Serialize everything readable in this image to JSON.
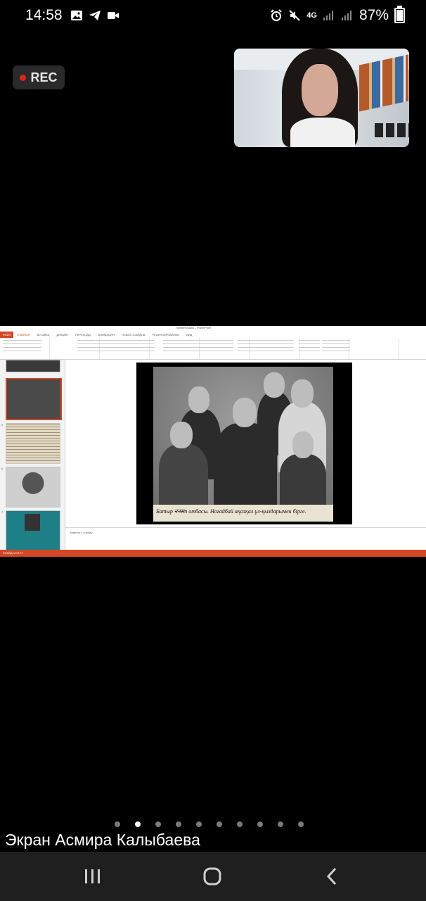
{
  "status_bar": {
    "time": "14:58",
    "network": "4G",
    "battery": "87%",
    "battery_level": 0.87
  },
  "recording": {
    "label": "REC",
    "dot_color": "#e3231b"
  },
  "shared_screen": {
    "app_title": "Презентация1 - PowerPoint",
    "file_tab": "ФАЙЛ",
    "tabs": [
      "ГЛАВНАЯ",
      "ВСТАВКА",
      "ДИЗАЙН",
      "ПЕРЕХОДЫ",
      "АНИМАЦИЯ",
      "ПОКАЗ СЛАЙДОВ",
      "РЕЦЕНЗИРОВАНИЕ",
      "ВИД"
    ],
    "active_tab": "ГЛАВНАЯ",
    "slide_caption": "Батыр ननसn отбасы. Ноғайбай ақсақал ұл-қыздарымен бірге.",
    "notes_placeholder": "Заметки к слайду",
    "status_text": "СЛАЙД 4 ИЗ 17",
    "accent_color": "#d24726"
  },
  "pager": {
    "count": 10,
    "active_index": 1
  },
  "screen_owner": "Экран Асмира Калыбаева",
  "nav": {
    "recents": "recents-icon",
    "home": "home-icon",
    "back": "back-icon"
  }
}
